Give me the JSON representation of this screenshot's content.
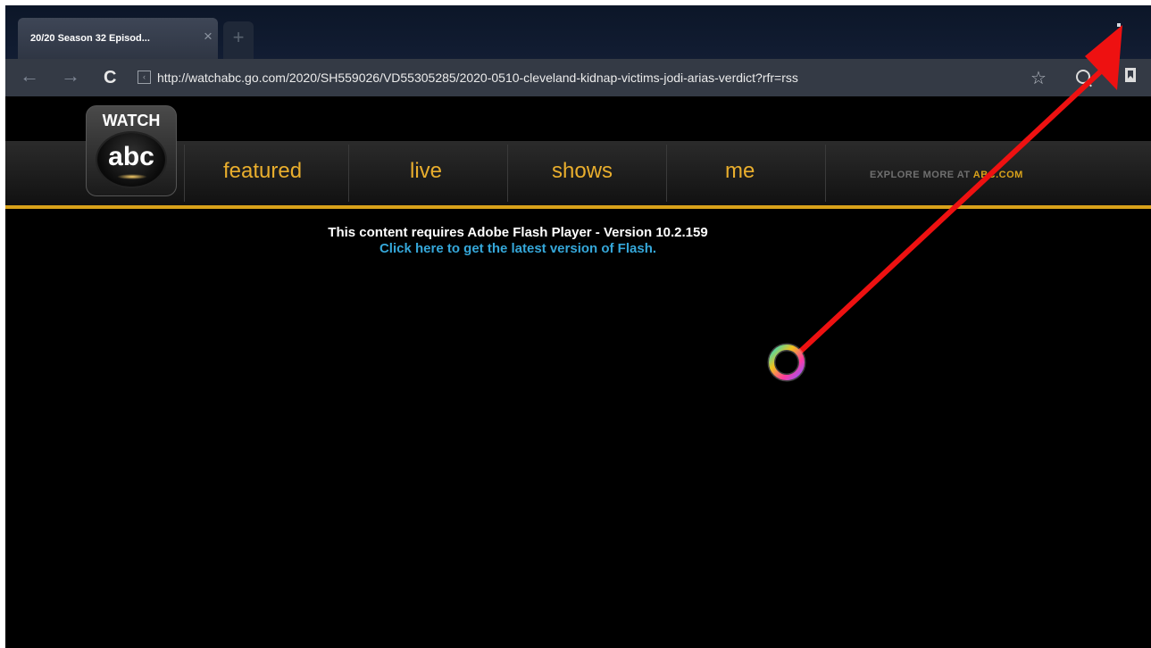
{
  "browser": {
    "tab_title": "20/20 Season 32 Episod...",
    "tab_close": "×",
    "new_tab": "+",
    "url": "http://watchabc.go.com/2020/SH559026/VD55305285/2020-0510-cleveland-kidnap-victims-jodi-arias-verdict?rfr=rss",
    "back": "←",
    "forward": "→",
    "reload": "C",
    "star": "☆"
  },
  "site": {
    "logo_watch": "WATCH",
    "logo_abc": "abc",
    "nav": [
      "featured",
      "live",
      "shows",
      "me"
    ],
    "explore_text": "EXPLORE MORE",
    "explore_at": "AT",
    "explore_abc": "ABC.COM"
  },
  "content": {
    "flash_message": "This content requires Adobe Flash Player - Version 10.2.159",
    "flash_link": "Click here to get the latest version of Flash."
  },
  "colors": {
    "nav_gold": "#e9ae2d",
    "link_blue": "#35a7d9",
    "annotation_red": "#ee1111"
  },
  "icons": [
    "back-icon",
    "forward-icon",
    "reload-icon",
    "site-info-icon",
    "star-icon",
    "search-icon",
    "bookmark-icon",
    "menu-dots-icon",
    "loading-spinner-icon"
  ]
}
